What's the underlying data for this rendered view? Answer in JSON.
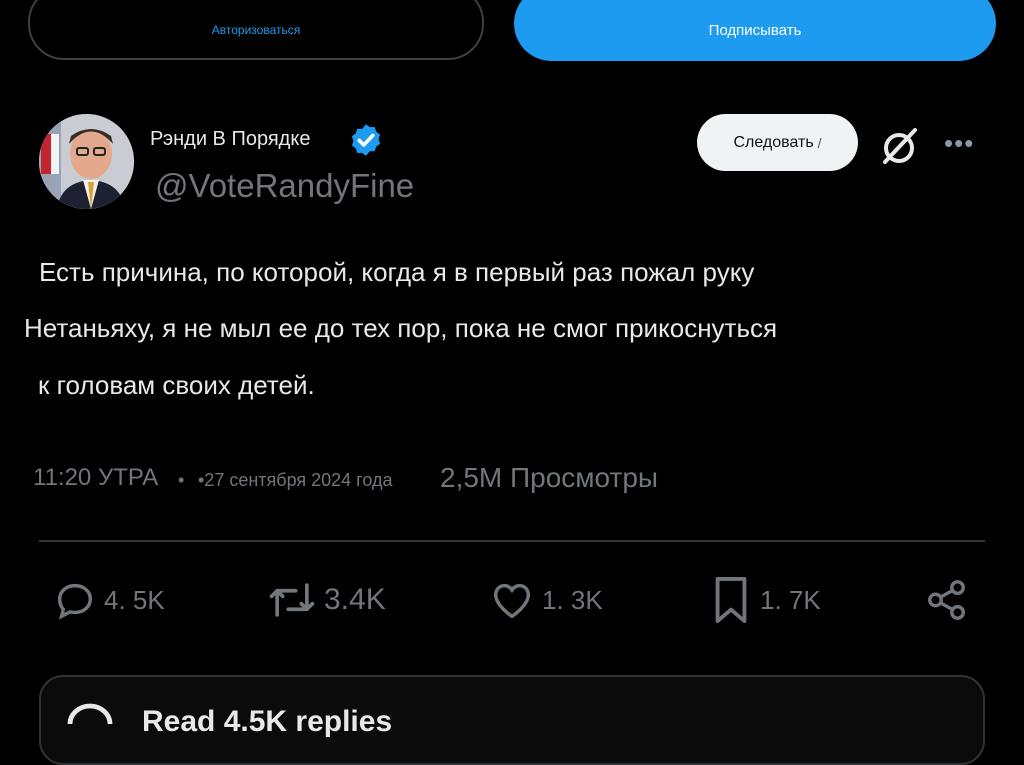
{
  "top_buttons": {
    "login_label": "Авторизоваться",
    "signup_label": "Подписывать"
  },
  "author": {
    "name": "Рэнди В Порядке",
    "handle": "@VoteRandyFine",
    "verified": true,
    "follow_label": "Следовать"
  },
  "tweet": {
    "lines": [
      "Есть причина, по которой, когда я в первый раз пожал руку",
      "Нетаньяху, я не мыл ее до тех пор, пока не смог прикоснуться",
      "к головам своих детей."
    ],
    "time": "11:20 УТРА",
    "date": "•27 сентября 2024 года",
    "views": "2,5M Просмотры"
  },
  "actions": {
    "replies": "4. 5K",
    "retweets": "3.4K",
    "likes": "1. 3K",
    "bookmarks": "1. 7K"
  },
  "read_replies": "Read 4.5K replies",
  "colors": {
    "background": "#000000",
    "accent": "#1d9bf0",
    "muted": "#71767b",
    "divider": "#2f3336"
  },
  "icons": [
    "verified-badge-icon",
    "grok-icon",
    "more-icon",
    "reply-icon",
    "retweet-icon",
    "like-icon",
    "bookmark-icon",
    "share-icon",
    "chat-bubble-icon"
  ]
}
